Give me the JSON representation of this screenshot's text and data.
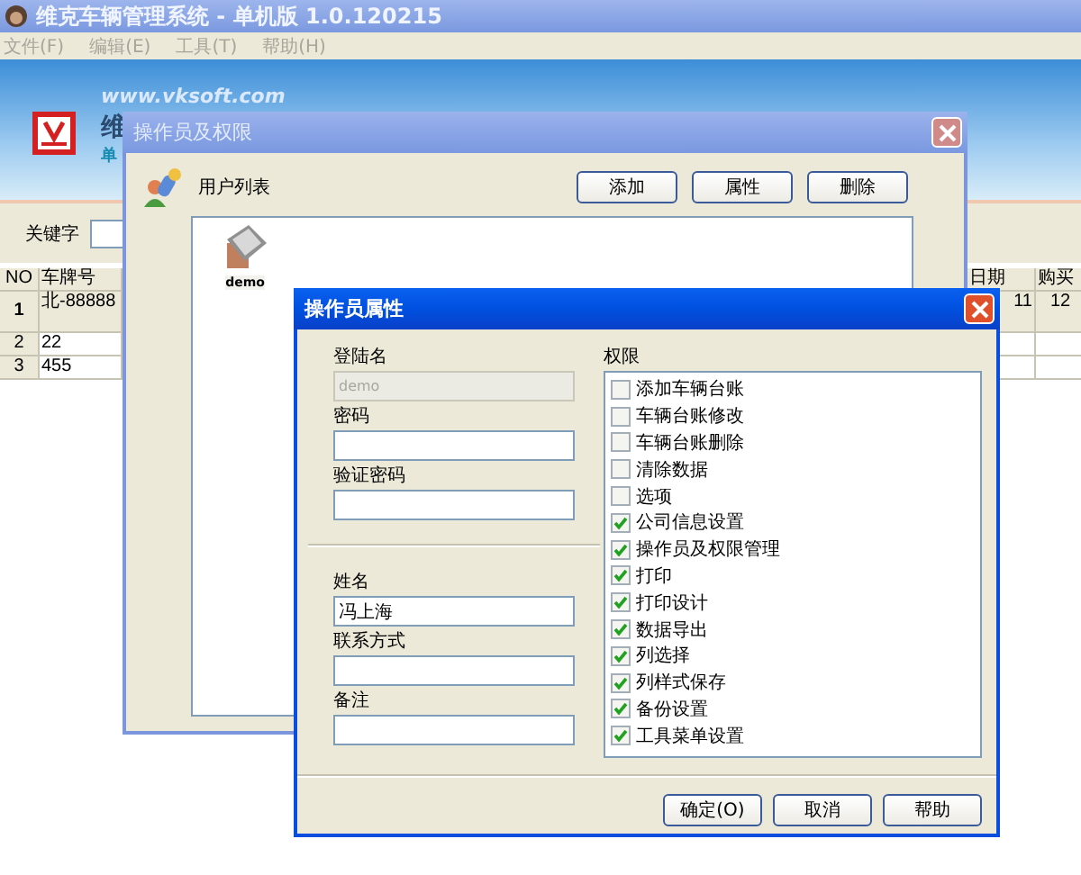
{
  "window": {
    "title": "维克车辆管理系统 - 单机版 1.0.120215"
  },
  "menu": [
    "文件(F)",
    "编辑(E)",
    "工具(T)",
    "帮助(H)"
  ],
  "banner": {
    "url": "www.vksoft.com",
    "title": "维",
    "subtitle": "单"
  },
  "search": {
    "label": "关键字"
  },
  "table": {
    "columns": [
      "NO",
      "车牌号",
      "日期",
      "购买"
    ],
    "rows": [
      {
        "selected": true,
        "cells": [
          "1",
          "北-88888",
          "11",
          "12"
        ]
      },
      {
        "selected": false,
        "cells": [
          "2",
          "22"
        ]
      },
      {
        "selected": false,
        "cells": [
          "3",
          "455"
        ]
      }
    ]
  },
  "operators_dialog": {
    "title": "操作员及权限",
    "list_label": "用户列表",
    "buttons": [
      "添加",
      "属性",
      "删除"
    ],
    "users": [
      {
        "name": "demo"
      }
    ]
  },
  "properties_dialog": {
    "title": "操作员属性",
    "account_fields": [
      {
        "label": "登陆名",
        "value": "demo",
        "disabled": true
      },
      {
        "label": "密码",
        "disabled": false
      },
      {
        "label": "验证密码",
        "disabled": false
      }
    ],
    "contact_fields": [
      {
        "label": "姓名",
        "value": "冯上海",
        "disabled": false
      },
      {
        "label": "联系方式",
        "disabled": false
      },
      {
        "label": "备注",
        "disabled": false
      }
    ],
    "permissions_label": "权限",
    "permissions": [
      {
        "label": "添加车辆台账",
        "checked": false
      },
      {
        "label": "车辆台账修改",
        "checked": false
      },
      {
        "label": "车辆台账删除",
        "checked": false
      },
      {
        "label": "清除数据",
        "checked": false
      },
      {
        "label": "选项",
        "checked": false
      },
      {
        "label": "公司信息设置",
        "checked": true
      },
      {
        "label": "操作员及权限管理",
        "checked": true
      },
      {
        "label": "打印",
        "checked": true
      },
      {
        "label": "打印设计",
        "checked": true
      },
      {
        "label": "数据导出",
        "checked": true
      },
      {
        "label": "列选择",
        "checked": true
      },
      {
        "label": "列样式保存",
        "checked": true
      },
      {
        "label": "备份设置",
        "checked": true
      },
      {
        "label": "工具菜单设置",
        "checked": true
      }
    ],
    "buttons": [
      "确定(O)",
      "取消",
      "帮助"
    ]
  }
}
